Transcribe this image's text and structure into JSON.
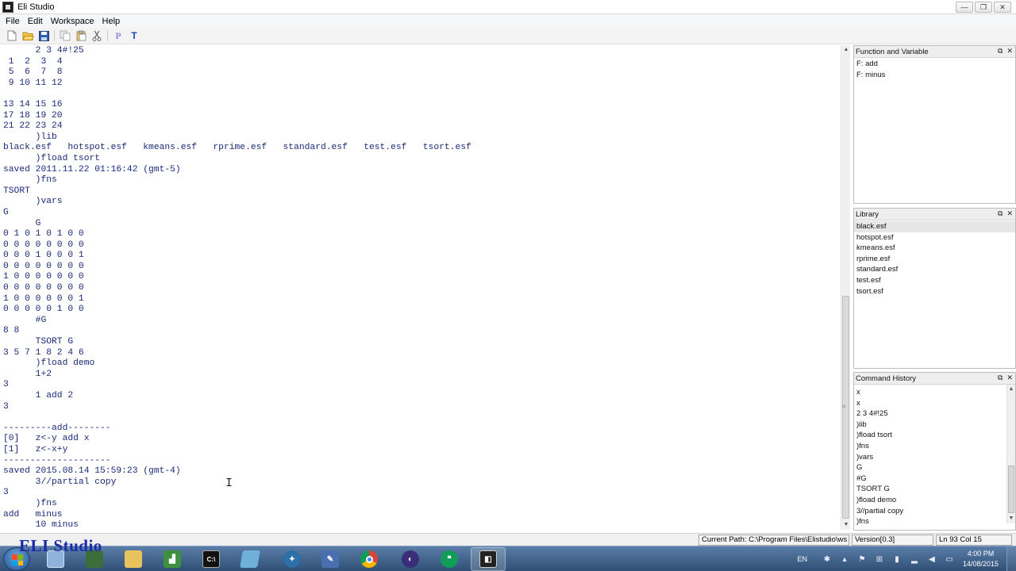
{
  "window": {
    "title": "Eli Studio",
    "buttons": [
      "—",
      "❐",
      "✕"
    ]
  },
  "menu": [
    "File",
    "Edit",
    "Workspace",
    "Help"
  ],
  "toolbar": {
    "items": [
      "new-file-icon",
      "open-folder-icon",
      "save-icon",
      "copy-icon",
      "paste-icon",
      "cut-icon",
      "P",
      "T"
    ],
    "p_label": "P",
    "t_label": "T"
  },
  "console": {
    "lines": [
      "      2 3 4#!25",
      " 1  2  3  4",
      " 5  6  7  8",
      " 9 10 11 12",
      "",
      "13 14 15 16",
      "17 18 19 20",
      "21 22 23 24",
      "      )lib",
      "black.esf   hotspot.esf   kmeans.esf   rprime.esf   standard.esf   test.esf   tsort.esf",
      "      )fload tsort",
      "saved 2011.11.22 01:16:42 (gmt-5)",
      "      )fns",
      "TSORT",
      "      )vars",
      "G",
      "      G",
      "0 1 0 1 0 1 0 0",
      "0 0 0 0 0 0 0 0",
      "0 0 0 1 0 0 0 1",
      "0 0 0 0 0 0 0 0",
      "1 0 0 0 0 0 0 0",
      "0 0 0 0 0 0 0 0",
      "1 0 0 0 0 0 0 1",
      "0 0 0 0 0 1 0 0",
      "      #G",
      "8 8",
      "      TSORT G",
      "3 5 7 1 8 2 4 6",
      "      )fload demo",
      "      1+2",
      "3",
      "      1 add 2",
      "3",
      "",
      "---------add--------",
      "[0]   z<-y add x",
      "[1]   z<-x+y",
      "--------------------",
      "saved 2015.08.14 15:59:23 (gmt-4)",
      "      3//partial copy",
      "3",
      "      )fns",
      "add   minus",
      "      10 minus"
    ]
  },
  "panels": {
    "functions": {
      "title": "Function and Variable",
      "items": [
        "F: add",
        "F: minus"
      ]
    },
    "library": {
      "title": "Library",
      "items": [
        "black.esf",
        "hotspot.esf",
        "kmeans.esf",
        "rprime.esf",
        "standard.esf",
        "test.esf",
        "tsort.esf"
      ]
    },
    "history": {
      "title": "Command History",
      "items": [
        "x",
        "x",
        "2 3 4#!25",
        ")lib",
        ")fload tsort",
        ")fns",
        ")vars",
        "G",
        "#G",
        "TSORT G",
        ")fload demo",
        "3//partial copy",
        ")fns"
      ]
    },
    "ctrl_restore": "⧉",
    "ctrl_close": "✕"
  },
  "status": {
    "path": "Current Path: C:\\Program Files\\Elistudio\\ws",
    "version": "Version[0.3]",
    "position": "Ln 93  Col 15"
  },
  "logo_text": "ELI Studio",
  "taskbar": {
    "apps": [
      "explorer",
      "media-center",
      "folder",
      "chart-app",
      "command-prompt",
      "virtualbox",
      "network-app",
      "paint-app",
      "chrome",
      "eclipse-app",
      "hangouts",
      "eli-studio"
    ],
    "lang": "EN",
    "time": "4:00 PM",
    "date": "14/08/2015"
  }
}
